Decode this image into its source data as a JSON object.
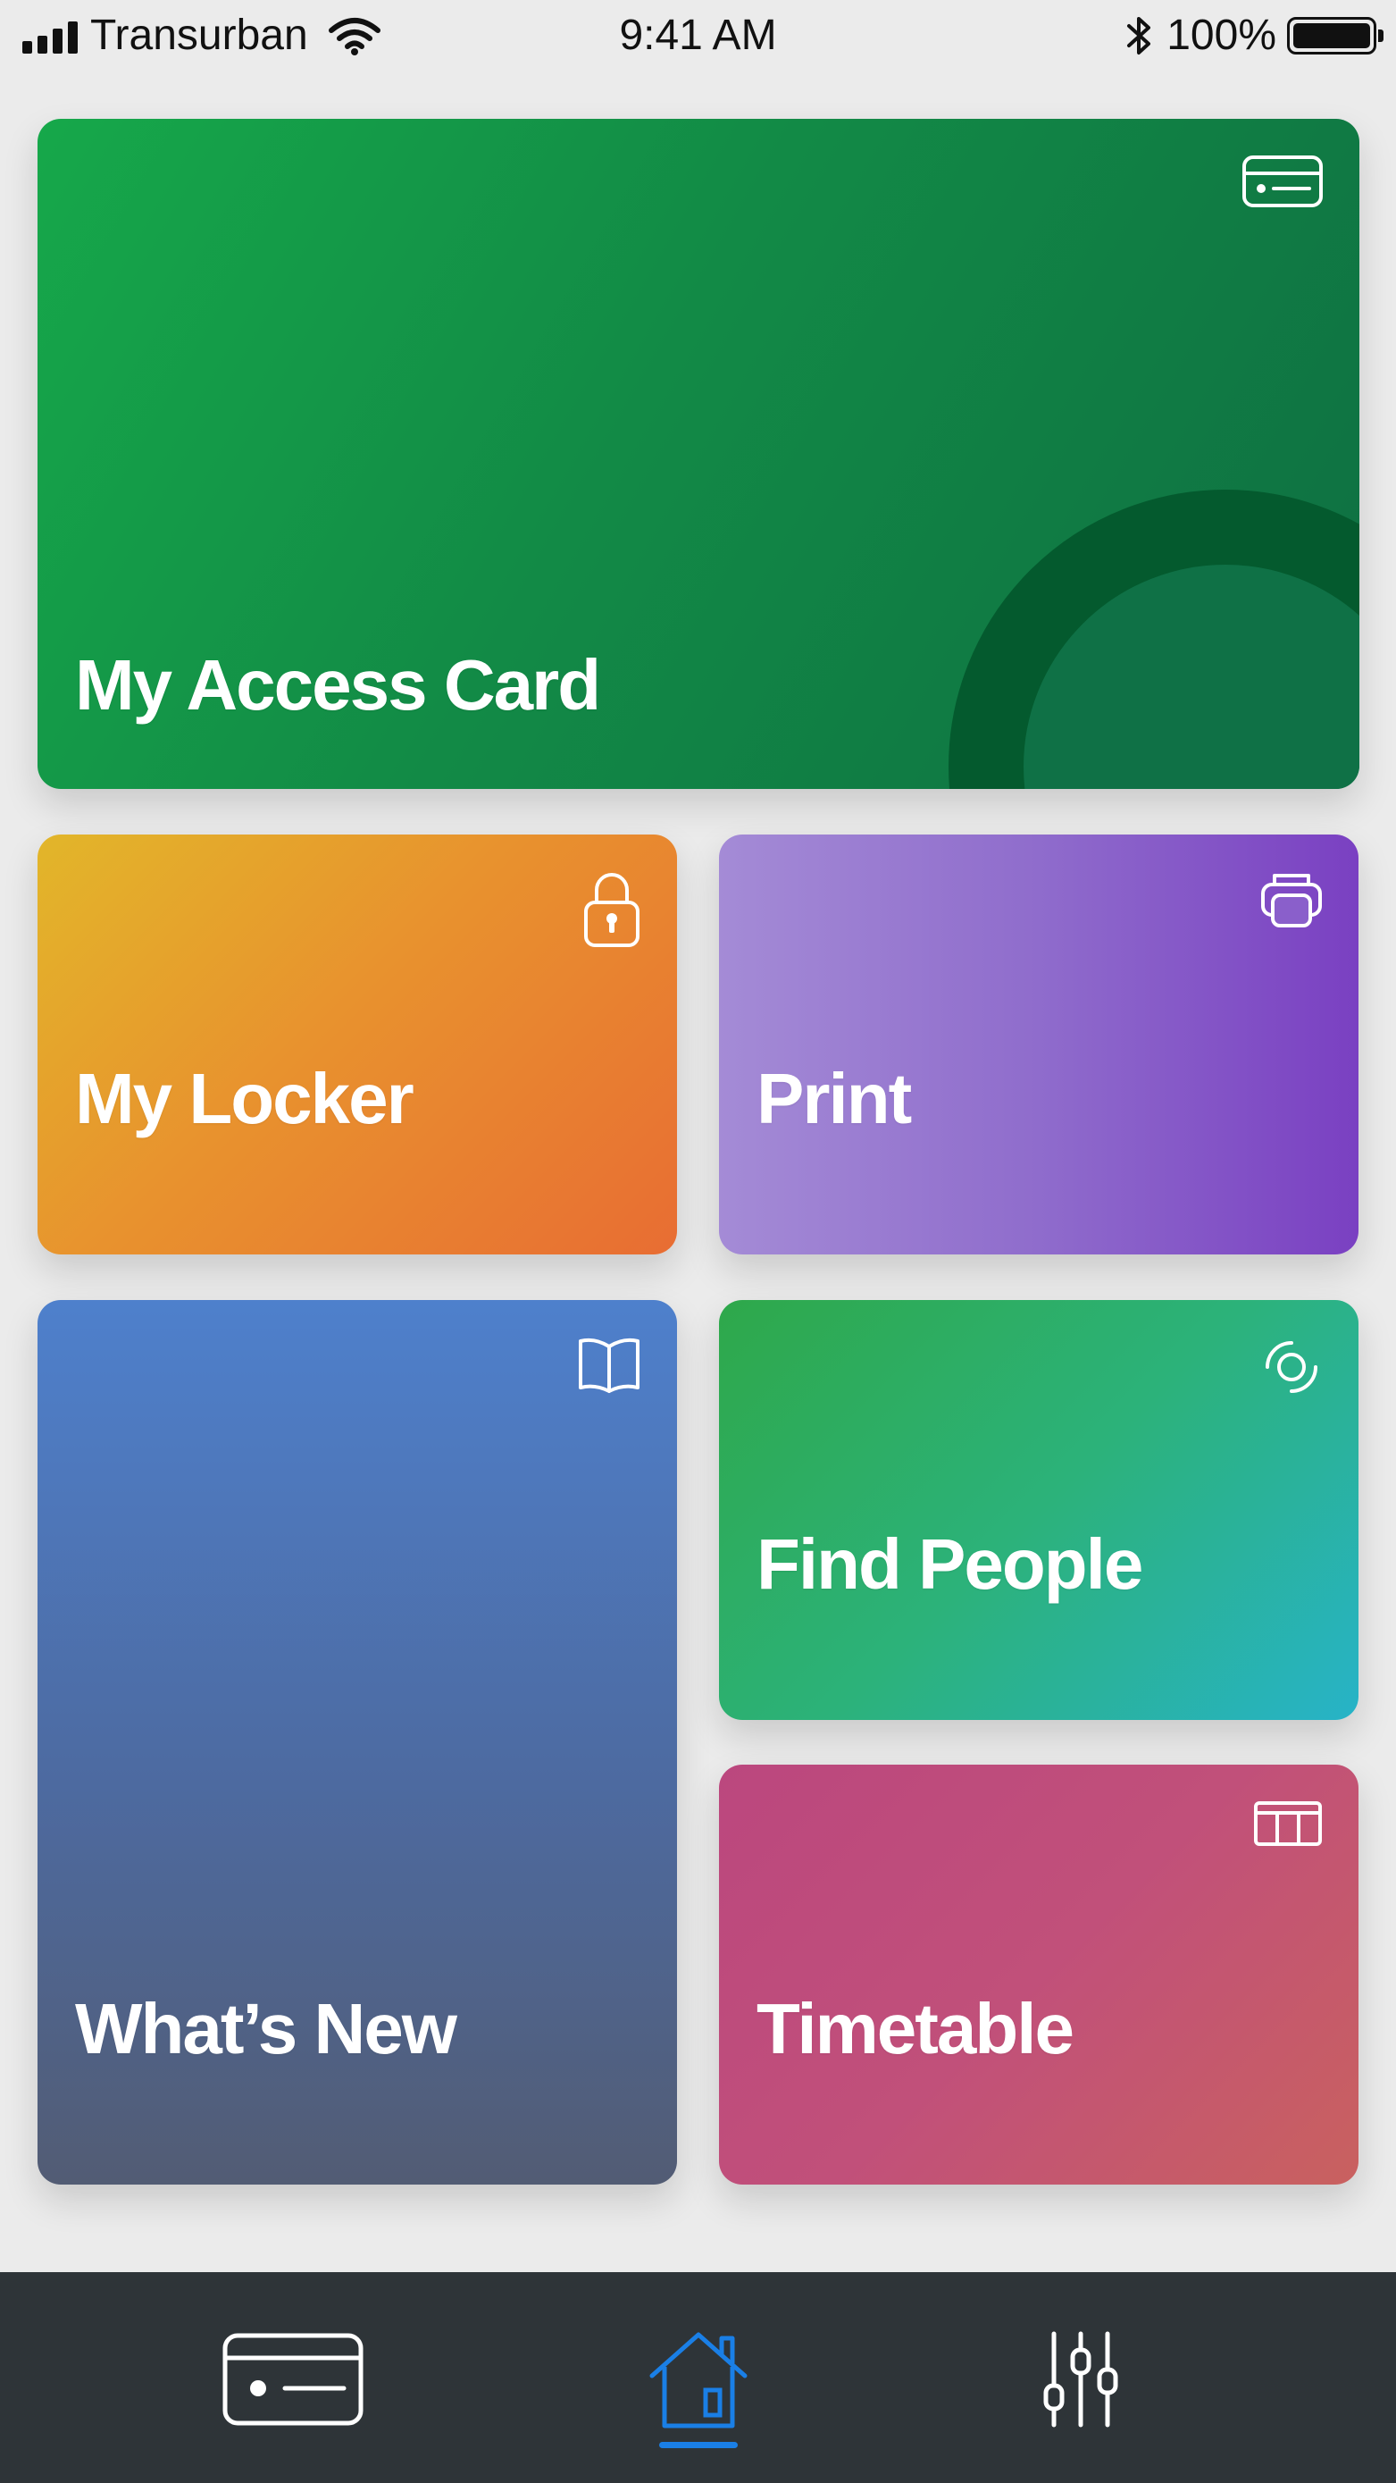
{
  "status_bar": {
    "carrier": "Transurban",
    "time": "9:41 AM",
    "battery": "100%",
    "icons": [
      "signal-icon",
      "wifi-icon",
      "bluetooth-icon",
      "battery-icon"
    ]
  },
  "tiles": {
    "access": {
      "label": "My Access Card",
      "icon": "card-icon",
      "color": "#16a84a"
    },
    "locker": {
      "label": "My Locker",
      "icon": "lock-icon",
      "color": "#e8922e"
    },
    "print": {
      "label": "Print",
      "icon": "printer-icon",
      "color": "#8f6ccc"
    },
    "news": {
      "label": "What’s New",
      "icon": "book-icon",
      "color": "#4e80cc"
    },
    "find": {
      "label": "Find People",
      "icon": "radar-icon",
      "color": "#2cb27a"
    },
    "timetable": {
      "label": "Timetable",
      "icon": "table-icon",
      "color": "#c1507a"
    }
  },
  "tab_bar": {
    "tabs": [
      {
        "name": "card",
        "icon": "card-icon",
        "active": false
      },
      {
        "name": "home",
        "icon": "home-icon",
        "active": true
      },
      {
        "name": "settings",
        "icon": "sliders-icon",
        "active": false
      }
    ],
    "active_color": "#1a7fe6",
    "background": "#2e3438"
  }
}
